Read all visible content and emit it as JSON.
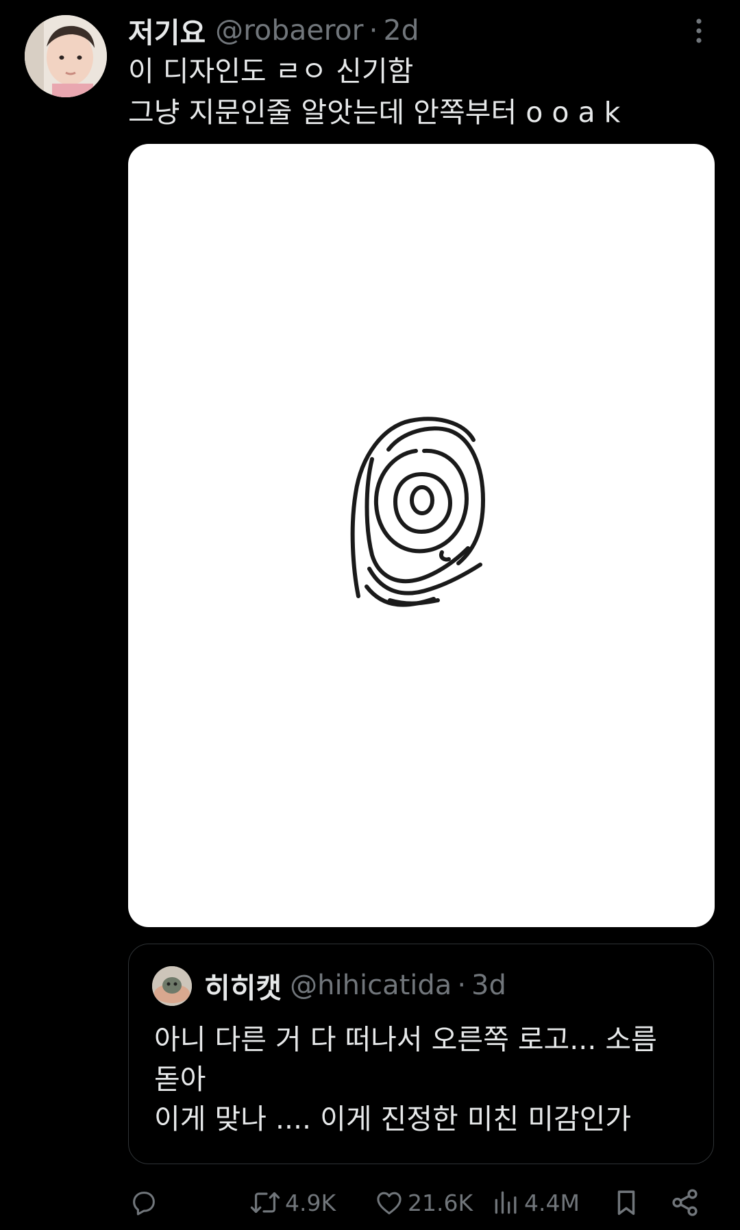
{
  "tweet": {
    "author": {
      "display_name": "저기요",
      "handle": "@robaeror"
    },
    "separator": "·",
    "time": "2d",
    "lines": [
      "이 디자인도 ㄹㅇ 신기함",
      "그냥 지문인줄 알앗는데 안쪽부터 o o a k"
    ],
    "icons": {
      "more": "more-vertical-icon"
    }
  },
  "quote": {
    "author": {
      "display_name": "히히캣",
      "handle": "@hihicatida"
    },
    "separator": "·",
    "time": "3d",
    "lines": [
      "아니 다른 거 다 떠나서 오른쪽 로고... 소름",
      "돋아",
      "이게 맞나 .... 이게 진정한 미친 미감인가"
    ]
  },
  "actions": {
    "reply": {
      "icon": "reply-icon",
      "count": ""
    },
    "retweet": {
      "icon": "retweet-icon",
      "count": "4.9K"
    },
    "like": {
      "icon": "heart-icon",
      "count": "21.6K"
    },
    "views": {
      "icon": "views-icon",
      "count": "4.4M"
    },
    "bookmark": {
      "icon": "bookmark-icon"
    },
    "share": {
      "icon": "share-icon"
    }
  },
  "colors": {
    "background": "#000000",
    "primary_text": "#e7e9ea",
    "secondary_text": "#71767b",
    "border": "#2f3336",
    "media_background": "#ffffff"
  }
}
